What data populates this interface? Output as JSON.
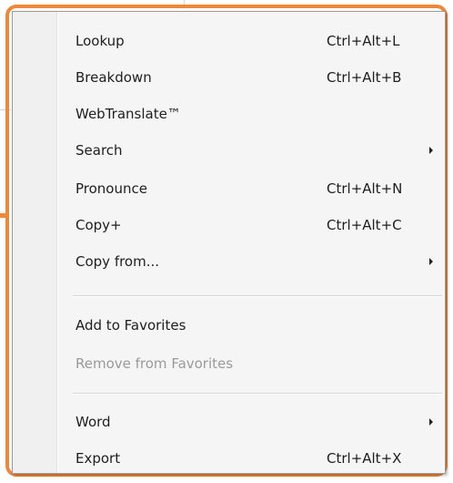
{
  "colors": {
    "highlight": "#f0883a",
    "menu_bg": "#f5f5f5",
    "text": "#1e1e1e",
    "disabled_text": "#9a9a9a"
  },
  "menu": {
    "items": [
      {
        "label": "Lookup",
        "shortcut": "Ctrl+Alt+L",
        "submenu": false,
        "disabled": false
      },
      {
        "label": "Breakdown",
        "shortcut": "Ctrl+Alt+B",
        "submenu": false,
        "disabled": false
      },
      {
        "label": "WebTranslate™",
        "shortcut": "",
        "submenu": false,
        "disabled": false
      },
      {
        "label": "Search",
        "shortcut": "",
        "submenu": true,
        "disabled": false
      },
      {
        "label": "Pronounce",
        "shortcut": "Ctrl+Alt+N",
        "submenu": false,
        "disabled": false
      },
      {
        "label": "Copy+",
        "shortcut": "Ctrl+Alt+C",
        "submenu": false,
        "disabled": false
      },
      {
        "label": "Copy from...",
        "shortcut": "",
        "submenu": true,
        "disabled": false
      },
      {
        "label": "Add to Favorites",
        "shortcut": "",
        "submenu": false,
        "disabled": false
      },
      {
        "label": "Remove from Favorites",
        "shortcut": "",
        "submenu": false,
        "disabled": true
      },
      {
        "label": "Word",
        "shortcut": "",
        "submenu": true,
        "disabled": false
      },
      {
        "label": "Export",
        "shortcut": "Ctrl+Alt+X",
        "submenu": false,
        "disabled": false
      }
    ]
  }
}
